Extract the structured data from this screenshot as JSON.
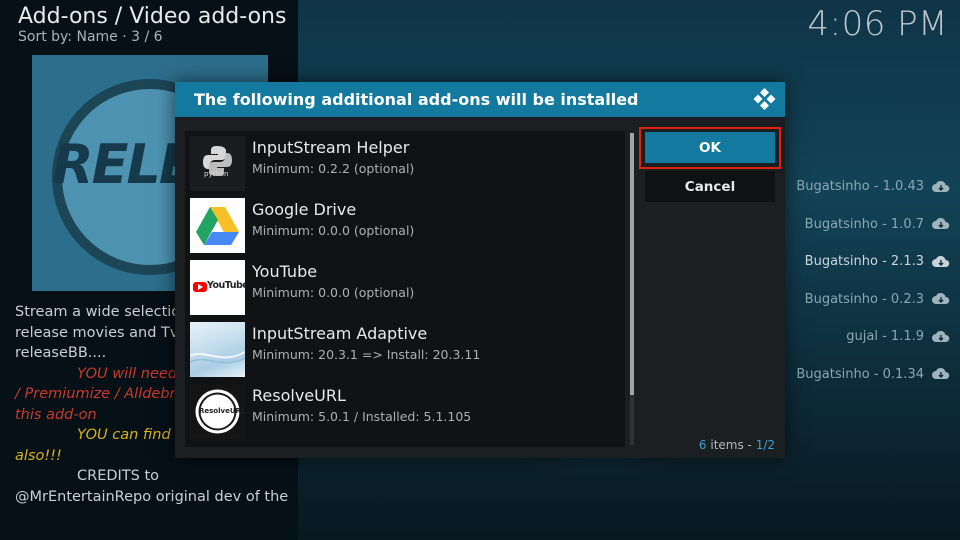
{
  "header": {
    "title": "Add-ons / Video add-ons",
    "sort": "Sort by: Name  ·  3 / 6",
    "clock": "4:06 PM"
  },
  "thumbnail": {
    "text": "RELEA"
  },
  "description": {
    "line1": "Stream a wide selectio",
    "line2": "release movies and Tv",
    "line3": "releaseBB....",
    "line4": "YOU will need",
    "line5": "/ Premiumize / Alldebri",
    "line6": "this add-on",
    "line7": "YOU can find",
    "line8": "also!!!",
    "line9": "CREDITS to",
    "line10": "@MrEntertainRepo original dev of the"
  },
  "versions": [
    {
      "label": "Bugatsinho - 1.0.43",
      "icon": "cloud-download-icon"
    },
    {
      "label": "Bugatsinho - 1.0.7",
      "icon": "cloud-download-icon"
    },
    {
      "label": "Bugatsinho - 2.1.3",
      "icon": "cloud-download-icon"
    },
    {
      "label": "Bugatsinho - 0.2.3",
      "icon": "cloud-download-icon"
    },
    {
      "label": "gujal - 1.1.9",
      "icon": "cloud-download-icon"
    },
    {
      "label": "Bugatsinho - 0.1.34",
      "icon": "cloud-download-icon"
    }
  ],
  "dialog": {
    "title": "The following additional add-ons will be installed",
    "ok_label": "OK",
    "cancel_label": "Cancel",
    "count_num": "6",
    "count_text": " items - ",
    "count_page": "1/2",
    "items": [
      {
        "name": "InputStream Helper",
        "desc": "Minimum: 0.2.2 (optional)",
        "icon": "python-icon",
        "icon_text": "python"
      },
      {
        "name": "Google Drive",
        "desc": "Minimum: 0.0.0 (optional)",
        "icon": "google-drive-icon"
      },
      {
        "name": "YouTube",
        "desc": "Minimum: 0.0.0 (optional)",
        "icon": "youtube-icon",
        "icon_text": "YouTube"
      },
      {
        "name": "InputStream Adaptive",
        "desc": "Minimum: 20.3.1 => Install: 20.3.11",
        "icon": "inputstream-adaptive-icon"
      },
      {
        "name": "ResolveURL",
        "desc": "Minimum: 5.0.1 / Installed: 5.1.105",
        "icon": "resolveurl-icon",
        "icon_text": "ResolveURL"
      }
    ]
  },
  "colors": {
    "accent": "#13799f",
    "highlight": "#e0230f"
  }
}
